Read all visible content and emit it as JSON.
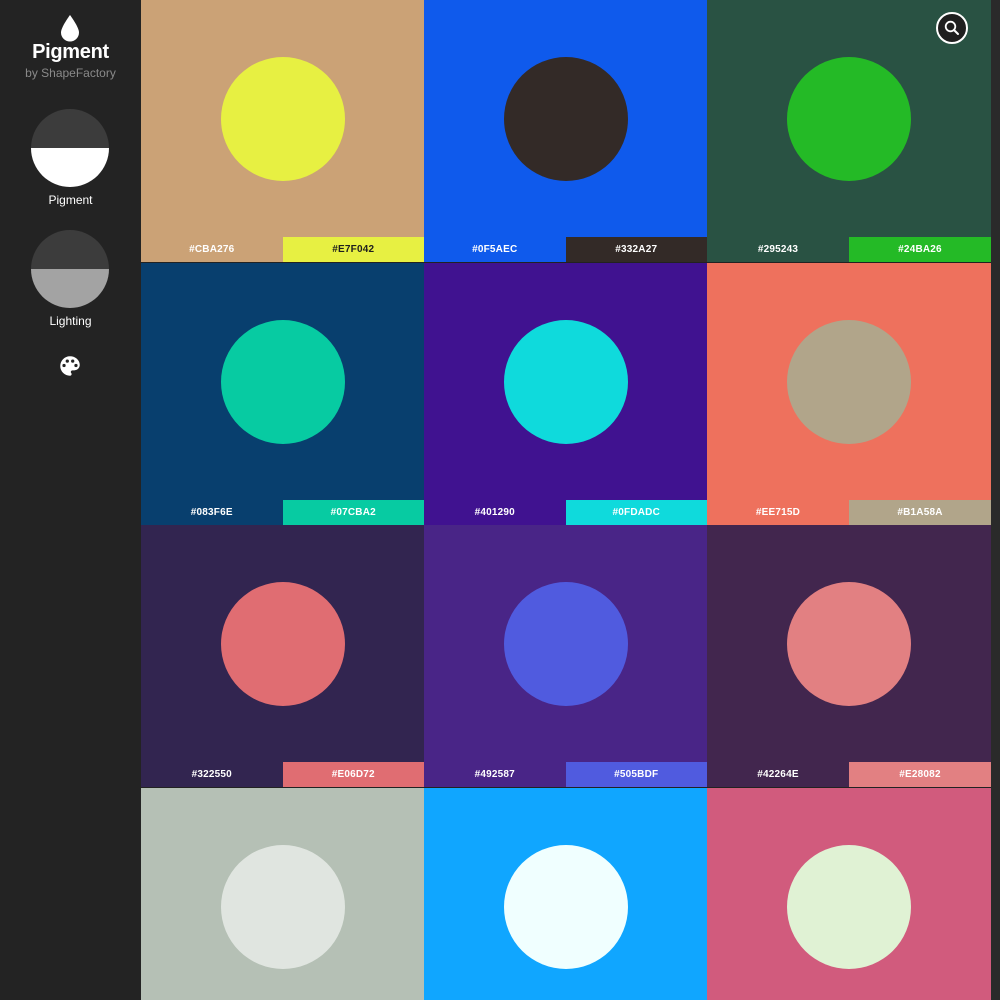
{
  "app": {
    "title": "Pigment",
    "subtitle": "by ShapeFactory",
    "icon": "water-drop-icon"
  },
  "sidebar": {
    "modes": [
      {
        "label": "Pigment",
        "top_color": "#3c3c3c",
        "bottom_color": "#ffffff",
        "active": true
      },
      {
        "label": "Lighting",
        "top_color": "#3c3c3c",
        "bottom_color": "#a3a3a3",
        "active": false
      }
    ],
    "palette_icon": "palette-icon"
  },
  "search": {
    "icon": "search-icon"
  },
  "cards": [
    {
      "bg": "#CBA276",
      "circle": "#E7F042",
      "codes": [
        "#CBA276",
        "#E7F042"
      ]
    },
    {
      "bg": "#0F5AEC",
      "circle": "#332A27",
      "codes": [
        "#0F5AEC",
        "#332A27"
      ]
    },
    {
      "bg": "#295243",
      "circle": "#24BA26",
      "codes": [
        "#295243",
        "#24BA26"
      ]
    },
    {
      "bg": "#083F6E",
      "circle": "#07CBA2",
      "codes": [
        "#083F6E",
        "#07CBA2"
      ]
    },
    {
      "bg": "#401290",
      "circle": "#0FDADC",
      "codes": [
        "#401290",
        "#0FDADC"
      ]
    },
    {
      "bg": "#EE715D",
      "circle": "#B1A58A",
      "codes": [
        "#EE715D",
        "#B1A58A"
      ]
    },
    {
      "bg": "#322550",
      "circle": "#E06D72",
      "codes": [
        "#322550",
        "#E06D72"
      ]
    },
    {
      "bg": "#492587",
      "circle": "#505BDF",
      "codes": [
        "#492587",
        "#505BDF"
      ]
    },
    {
      "bg": "#42264E",
      "circle": "#E28082",
      "codes": [
        "#42264E",
        "#E28082"
      ]
    },
    {
      "bg": "#B5C0B5",
      "circle": "#E0E5E0",
      "codes": [
        "",
        ""
      ]
    },
    {
      "bg": "#10A6FF",
      "circle": "#F0FFFF",
      "codes": [
        "",
        ""
      ]
    },
    {
      "bg": "#D15B7D",
      "circle": "#E0F2D4",
      "codes": [
        "",
        ""
      ]
    }
  ]
}
